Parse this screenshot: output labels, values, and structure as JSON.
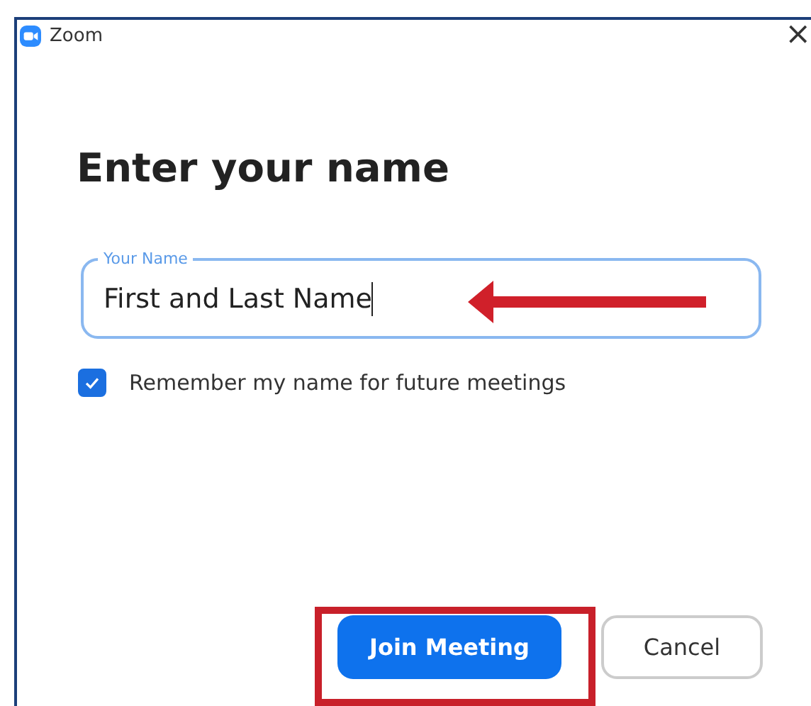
{
  "window": {
    "title": "Zoom",
    "close": "×"
  },
  "heading": "Enter your name",
  "name_field": {
    "label": "Your Name",
    "value": "First and Last Name"
  },
  "remember": {
    "label": "Remember my name for future meetings",
    "checked": true
  },
  "buttons": [
    {
      "label": "Join Meeting",
      "kind": "primary"
    },
    {
      "label": "Cancel",
      "kind": "secondary"
    }
  ]
}
